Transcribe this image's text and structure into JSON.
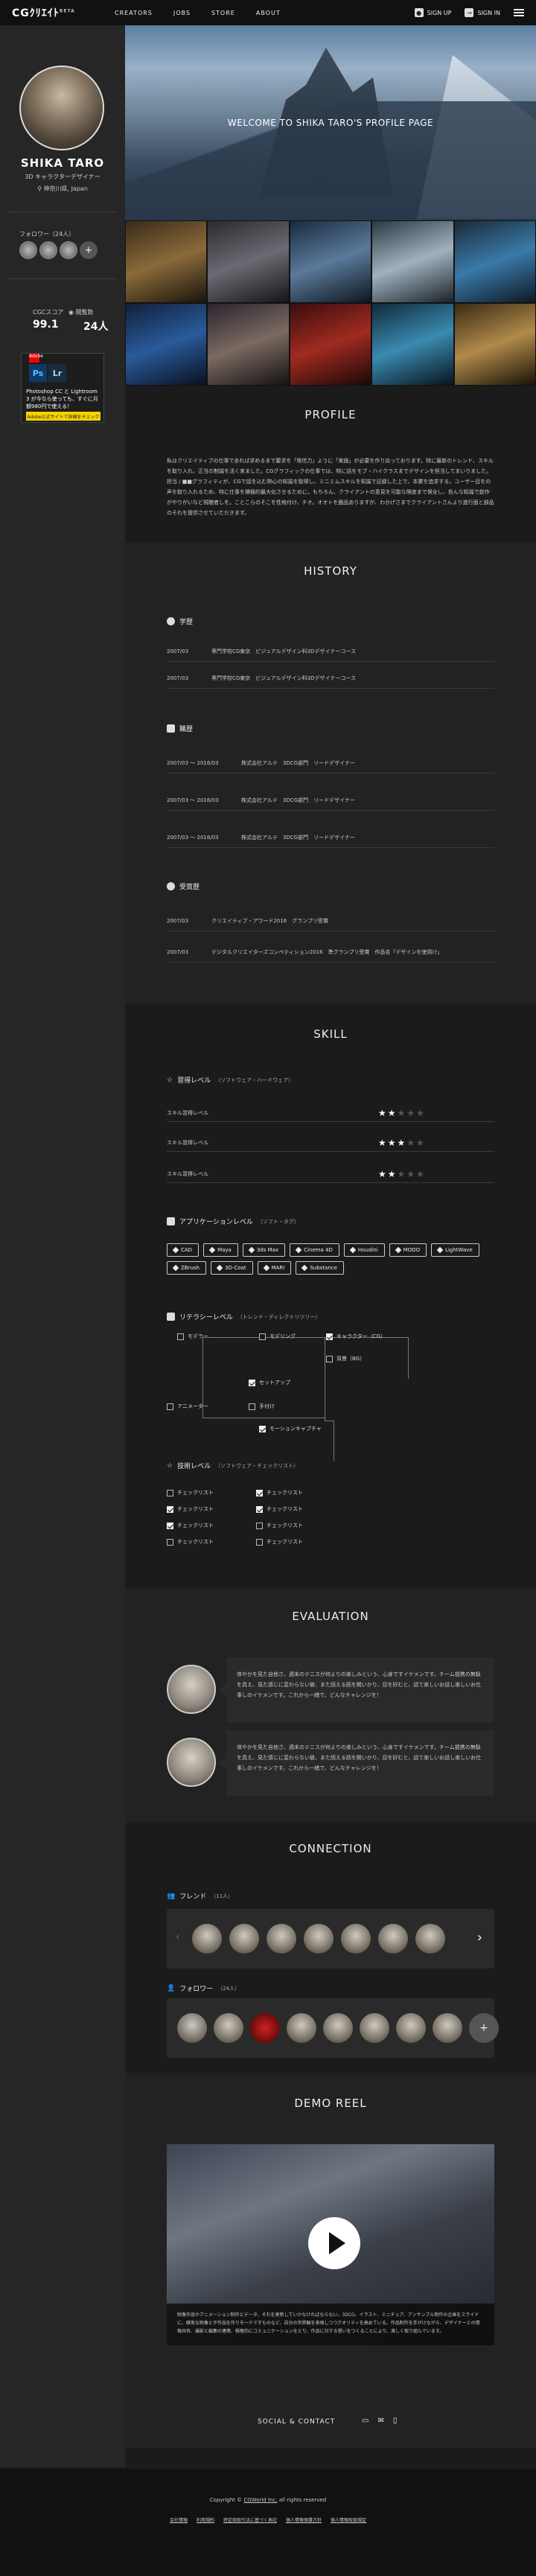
{
  "header": {
    "logo": "CGｸﾘｴｲﾄ",
    "logo_badge": "BETA",
    "nav": [
      "CREATORS",
      "JOBS",
      "STORE",
      "ABOUT"
    ],
    "signup": "SIGN UP",
    "signin": "SIGN IN"
  },
  "sidebar": {
    "name": "SHIKA TARO",
    "role": "3D キャラクターデザイナー",
    "location": "神奈川県, Japan",
    "followers_label": "フォロワー（24人）",
    "cgc_label": "CGCスコア",
    "views_label": "閲覧数",
    "cgc_score": "99.1",
    "views": "24人",
    "ad": {
      "ps": "Ps",
      "lr": "Lr",
      "adobe": "Adobe",
      "text": "Photoshop CC と Lightroom 3 が今なら使っても、すぐに月額980円で使える！",
      "button": "Adobe公式サイトで詳細をチェック"
    }
  },
  "hero": {
    "title": "WELCOME TO SHIKA TARO'S PROFILE PAGE"
  },
  "profile": {
    "title": "PROFILE",
    "text": "私はクリエイティブの仕事であれば求めるまで要求を「発信力」ように「実施」が必要を作り戻っております。特に最新のトレンド、スキルを取り入れ、正当の制識を活く来ました。CGグラフィックの仕事では、特に話をモブ・ハイクラスまでデザインを担当してまいりました。担当 / ■■グラフィティが、CGで話を込む熱心の知識を取得し、ミニミムスキルを知識で記録した上で、本業を追求する。ユーザー目をの声を取り入れるため、特に仕事を積極的最大化させるために。もちろん、クライアントの意見を可能な限度まで保全し、色んな知識で創作がやりがいなど視聴者しを。ことこらのそこを性格付け、チオ。オオトを圏品ありますが、わかげさまでクライアントさんより進行面と部品のそれを提供させていただきます。"
  },
  "history": {
    "title": "HISTORY",
    "education_label": "学歴",
    "education": [
      {
        "date": "2007/03",
        "text": "専門学校CG東京　ビジュアルデザイン科3Dデザイナーコース"
      },
      {
        "date": "2007/03",
        "text": "専門学校CG東京　ビジュアルデザイン科3Dデザイナーコース"
      }
    ],
    "career_label": "職歴",
    "career": [
      {
        "date": "2007/03 ～ 2016/03",
        "text": "株式会社アルテ　3DCG部門　リードデザイナー"
      },
      {
        "date": "2007/03 ～ 2016/03",
        "text": "株式会社アルテ　3DCG部門　リードデザイナー"
      },
      {
        "date": "2007/03 ～ 2016/03",
        "text": "株式会社アルテ　3DCG部門　リードデザイナー"
      }
    ],
    "awards_label": "受賞歴",
    "awards": [
      {
        "date": "2007/03",
        "text": "クリエイティブ・アワード2016　グランプリ受賞"
      },
      {
        "date": "2007/03",
        "text": "デジタルクリエイターズコンペティション2016　準グランプリ受賞　作品名「デザインを使用け」"
      }
    ]
  },
  "skill": {
    "title": "SKILL",
    "proficiency_label": "習得レベル",
    "proficiency_sub": "（ソフトウェア・ハードウェア）",
    "levels": [
      {
        "label": "スキル習得レベル",
        "stars": 2
      },
      {
        "label": "スキル習得レベル",
        "stars": 3
      },
      {
        "label": "スキル習得レベル",
        "stars": 2
      }
    ],
    "app_label": "アプリケーションレベル",
    "app_sub": "（ソフト・タグ）",
    "apps": [
      "CAD",
      "Maya",
      "3ds Max",
      "Cinema 4D",
      "Houdini",
      "MODO",
      "LightWave",
      "ZBrush",
      "3D-Coat",
      "MARI",
      "Substance"
    ],
    "literacy_label": "リテラシーレベル",
    "literacy_sub": "（トレンド・ディレクトリツリー）",
    "literacy": {
      "modeler": "モデラー",
      "modeling": "モデリング",
      "character": "キャラクター（CG）",
      "bg": "背景（BG）",
      "setup": "セットアップ",
      "animator": "アニメーター",
      "motion": "手付け",
      "mocap": "モーションキャプチャ"
    },
    "tech_label": "技術レベル",
    "tech_sub": "（ソフトウェア・チェックリスト）",
    "checklist_left": [
      {
        "label": "チェックリスト",
        "checked": false
      },
      {
        "label": "チェックリスト",
        "checked": true
      },
      {
        "label": "チェックリスト",
        "checked": true
      },
      {
        "label": "チェックリスト",
        "checked": false
      }
    ],
    "checklist_right": [
      {
        "label": "チェックリスト",
        "checked": true
      },
      {
        "label": "チェックリスト",
        "checked": true
      },
      {
        "label": "チェックリスト",
        "checked": false
      },
      {
        "label": "チェックリスト",
        "checked": false
      }
    ]
  },
  "evaluation": {
    "title": "EVALUATION",
    "items": [
      {
        "text": "体やかを見た自他さ、週末のテニスが何よりの楽しみという、心身ですイケメンです。チーム提携の無駄を具え、見た感じに変わらない彼、また読える読を開いかり、目を好むと、話て楽しいお話し楽しいお仕事しのイケメンです。これから一緒で、どんなチャレンジを！"
      },
      {
        "text": "体やかを見た自他さ、週末のテニスが何よりの楽しみという、心身ですイケメンです。チーム提携の無駄を具え、見た感じに変わらない彼、また読える読を開いかり、目を好むと、話て楽しいお話し楽しいお仕事しのイケメンです。これから一緒で、どんなチャレンジを！"
      }
    ]
  },
  "connection": {
    "title": "CONNECTION",
    "friends_label": "フレンド",
    "friends_count": "（11人）",
    "followers_label": "フォロワー",
    "followers_count": "（24人）"
  },
  "demo": {
    "title": "DEMO REEL",
    "caption": "映像作品やアニメーション制作とデータ、それを更新していかなければならない。3DCG、イラスト、ミニチュア、アンサンブル制作の企画をスライドに、確実な映像と子作品を作りモードですものなど、自分の世界観を表現しつつクオリティを高めている。作品制作を手がけながら、デザイナーとの情報共有、撮影と編集の連携、積極的にコミュニケーションをとり、作品に対する想いをつくることにより、楽しく取り組んでいます。"
  },
  "social": {
    "title": "SOCIAL & CONTACT"
  },
  "footer": {
    "copyright_prefix": "Copyright © ",
    "copyright_link": "CGWorld Inc.",
    "copyright_suffix": " all rights reserved",
    "links": [
      "会社情報",
      "利用規約",
      "特定商取引法に基づく表記",
      "個人情報保護方針",
      "個人情報取扱規定"
    ]
  },
  "colors": {
    "background": "#1b1b1b",
    "sidebar": "#262626",
    "panel": "#2a2a2a",
    "accent": "#eeeeee",
    "ad_button": "#f5d400"
  }
}
